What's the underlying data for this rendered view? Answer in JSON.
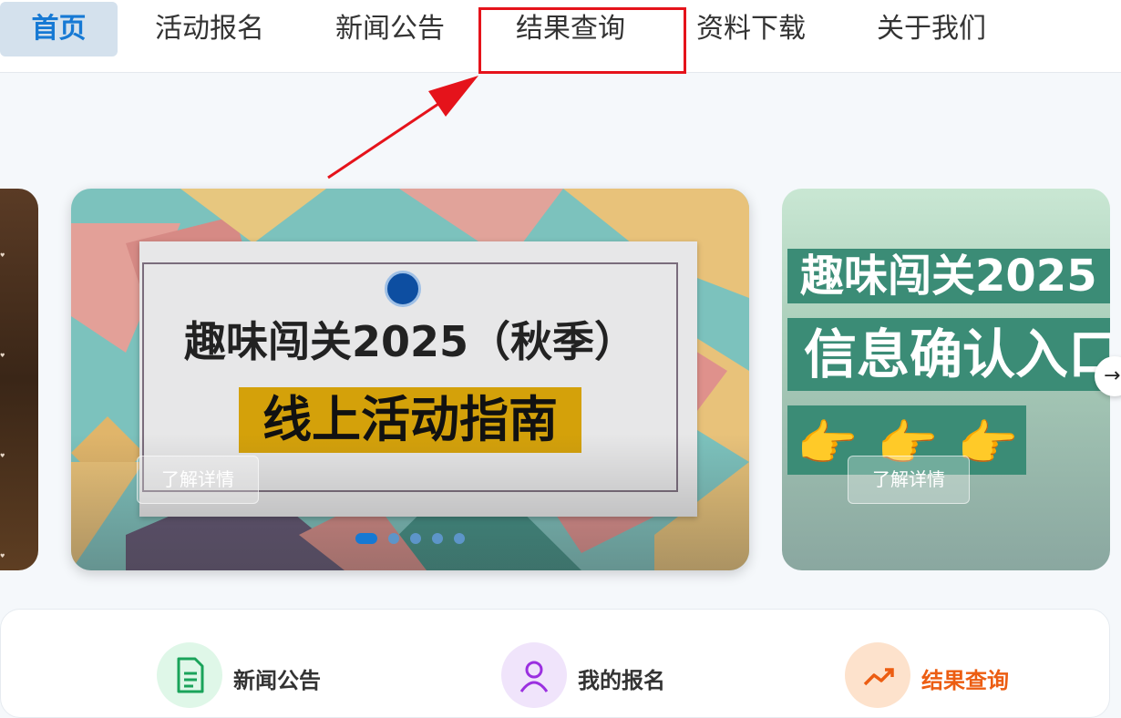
{
  "nav": {
    "items": [
      {
        "label": "首页",
        "active": true
      },
      {
        "label": "活动报名"
      },
      {
        "label": "新闻公告"
      },
      {
        "label": "结果查询",
        "highlighted": true
      },
      {
        "label": "资料下载"
      },
      {
        "label": "关于我们"
      }
    ]
  },
  "carousel": {
    "main": {
      "title": "趣味闯关2025（秋季）",
      "subtitle": "线上活动指南",
      "button": "了解详情"
    },
    "next": {
      "title_line1": "趣味闯关2025",
      "title_line2": "信息确认入口",
      "button": "了解详情"
    },
    "slide_count": 5,
    "active_index": 0
  },
  "quick_links": [
    {
      "label": "新闻公告",
      "icon": "document-icon",
      "color": "#1aa35a",
      "bg": "#dff7e8"
    },
    {
      "label": "我的报名",
      "icon": "user-icon",
      "color": "#9b30e0",
      "bg": "#f0e4fb"
    },
    {
      "label": "结果查询",
      "icon": "trending-up-icon",
      "color": "#ec5d12",
      "bg": "#fde2cc"
    }
  ],
  "colors": {
    "accent": "#1679d4",
    "highlight_red": "#e5131b"
  }
}
